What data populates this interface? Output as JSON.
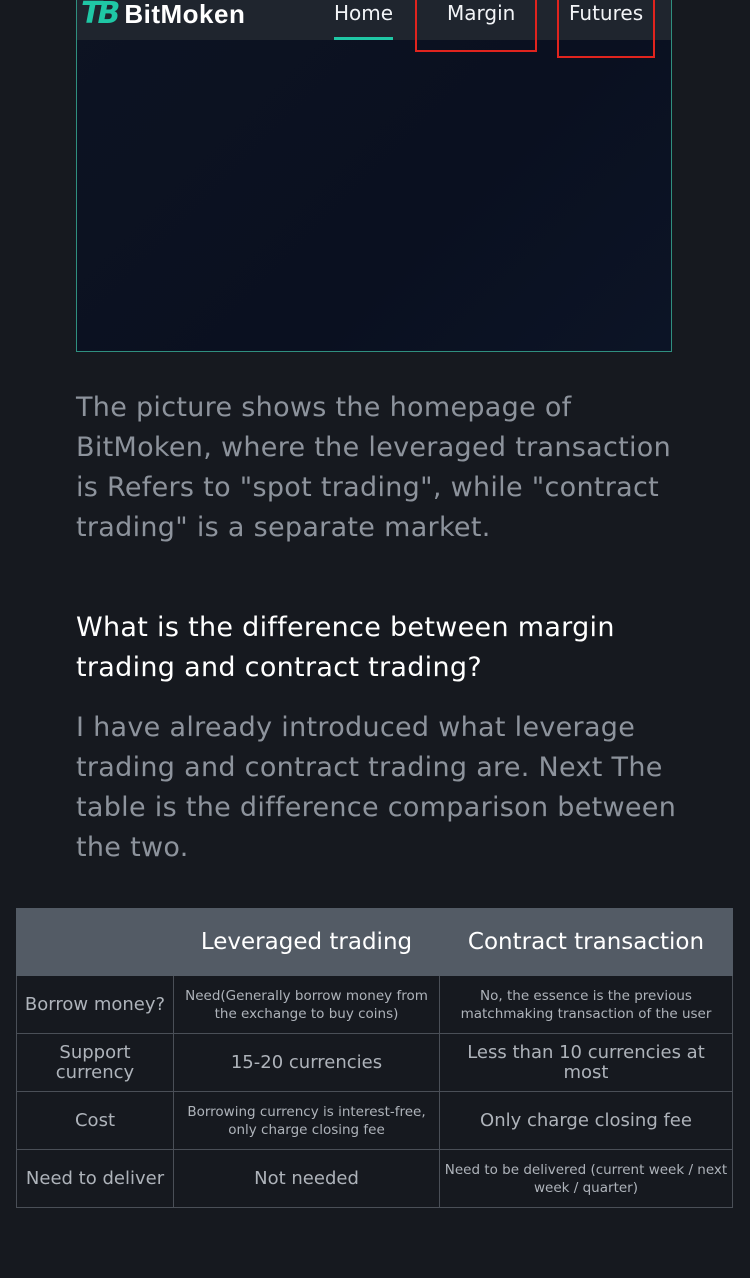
{
  "nav": {
    "logo_text": "BitMoken",
    "items": [
      "Home",
      "Margin",
      "Futures"
    ]
  },
  "colors": {
    "accent": "#1fc7a5",
    "highlight_box": "#e0241e",
    "background": "#16191f"
  },
  "content": {
    "paragraph1": "The picture shows the homepage of BitMoken, where the leveraged transaction is Refers to \"spot trading\", while \"contract trading\" is a separate market.",
    "heading": "What is the difference between margin trading and contract trading?",
    "paragraph2": "I have already introduced what leverage trading and contract trading are. Next The table is the difference comparison between the two."
  },
  "table": {
    "headers": [
      "",
      "Leveraged trading",
      "Contract transaction"
    ],
    "rows": [
      [
        "Borrow money?",
        "Need(Generally borrow money from the exchange to buy coins)",
        "No, the essence is the previous matchmaking transaction of the user"
      ],
      [
        "Support currency",
        "15-20 currencies",
        "Less than 10 currencies at most"
      ],
      [
        "Cost",
        "Borrowing currency is interest-free, only charge closing fee",
        "Only charge closing fee"
      ],
      [
        "Need to deliver",
        "Not needed",
        "Need to be delivered (current week / next week / quarter)"
      ]
    ]
  }
}
